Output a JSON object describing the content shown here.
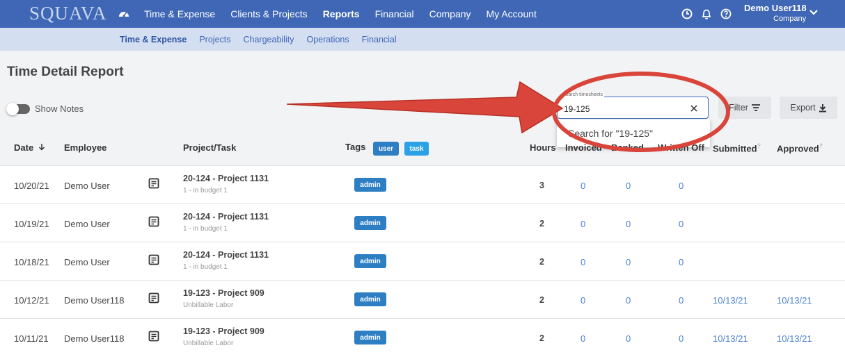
{
  "app": {
    "logo": "SQUAVA"
  },
  "topnav": {
    "items": [
      {
        "label": "Time & Expense",
        "active": false
      },
      {
        "label": "Clients & Projects",
        "active": false
      },
      {
        "label": "Reports",
        "active": true
      },
      {
        "label": "Financial",
        "active": false
      },
      {
        "label": "Company",
        "active": false
      },
      {
        "label": "My Account",
        "active": false
      }
    ],
    "user_name": "Demo User118",
    "user_company": "Company"
  },
  "subnav": {
    "items": [
      {
        "label": "Time & Expense",
        "active": true
      },
      {
        "label": "Projects",
        "active": false
      },
      {
        "label": "Chargeability",
        "active": false
      },
      {
        "label": "Operations",
        "active": false
      },
      {
        "label": "Financial",
        "active": false
      }
    ]
  },
  "page": {
    "title": "Time Detail Report",
    "toggle_label": "Show Notes",
    "toggle_on": false
  },
  "search": {
    "float_label": "Search timesheets",
    "value": "19-125",
    "suggestion": "Search for \"19-125\""
  },
  "buttons": {
    "filter": "Filter",
    "export": "Export"
  },
  "table": {
    "headers": {
      "date": "Date",
      "employee": "Employee",
      "project": "Project/Task",
      "tags": "Tags",
      "hours": "Hours",
      "invoiced": "Invoiced",
      "banked": "Banked",
      "written_off": "Written Off",
      "submitted": "Submitted",
      "approved": "Approved"
    },
    "header_tags": [
      "user",
      "task"
    ],
    "rows": [
      {
        "date": "10/20/21",
        "employee": "Demo User",
        "project": "20-124 - Project 1131",
        "task": "1 - in budget 1",
        "tag": "admin",
        "hours": "3",
        "invoiced": "0",
        "banked": "0",
        "written_off": "0",
        "submitted": "",
        "approved": ""
      },
      {
        "date": "10/19/21",
        "employee": "Demo User",
        "project": "20-124 - Project 1131",
        "task": "1 - in budget 1",
        "tag": "admin",
        "hours": "2",
        "invoiced": "0",
        "banked": "0",
        "written_off": "0",
        "submitted": "",
        "approved": ""
      },
      {
        "date": "10/18/21",
        "employee": "Demo User",
        "project": "20-124 - Project 1131",
        "task": "1 - in budget 1",
        "tag": "admin",
        "hours": "2",
        "invoiced": "0",
        "banked": "0",
        "written_off": "0",
        "submitted": "",
        "approved": ""
      },
      {
        "date": "10/12/21",
        "employee": "Demo User118",
        "project": "19-123 - Project 909",
        "task": "Unbillable Labor",
        "tag": "admin",
        "hours": "2",
        "invoiced": "0",
        "banked": "0",
        "written_off": "0",
        "submitted": "10/13/21",
        "approved": "10/13/21"
      },
      {
        "date": "10/11/21",
        "employee": "Demo User118",
        "project": "19-123 - Project 909",
        "task": "Unbillable Labor",
        "tag": "admin",
        "hours": "2",
        "invoiced": "0",
        "banked": "0",
        "written_off": "0",
        "submitted": "10/13/21",
        "approved": "10/13/21"
      }
    ]
  },
  "colors": {
    "nav_bg": "#3f67b6",
    "subnav_bg": "#d3def1",
    "tag": "#2e7ec4",
    "link": "#4a7fd4",
    "annotation": "#d9453a"
  }
}
